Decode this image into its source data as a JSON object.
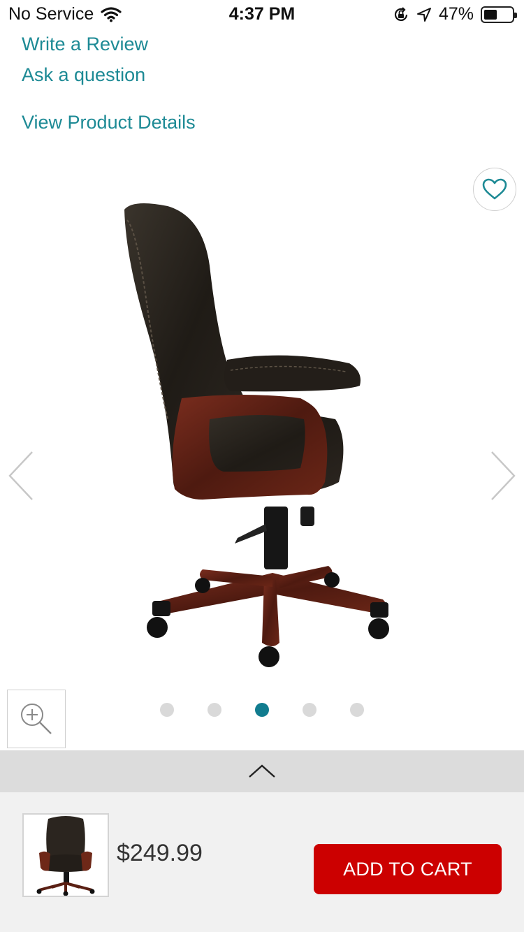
{
  "status_bar": {
    "carrier": "No Service",
    "time": "4:37 PM",
    "battery": "47%",
    "battery_level": 0.47
  },
  "links": {
    "write_review": "Write a Review",
    "ask_question": "Ask a question",
    "view_details": "View Product Details"
  },
  "gallery": {
    "total_images": 5,
    "active_index": 2
  },
  "purchase": {
    "price": "$249.99",
    "add_to_cart_label": "ADD TO CART"
  },
  "colors": {
    "link": "#1d8a95",
    "accent_dot": "#117c8f",
    "cart_button": "#cc0000"
  },
  "icons": {
    "favorite": "heart-icon",
    "zoom": "zoom-in-icon",
    "prev": "chevron-left-icon",
    "next": "chevron-right-icon",
    "collapse": "chevron-up-icon",
    "wifi": "wifi-icon",
    "orientation_lock": "orientation-lock-icon",
    "location": "location-arrow-icon",
    "battery": "battery-icon"
  }
}
